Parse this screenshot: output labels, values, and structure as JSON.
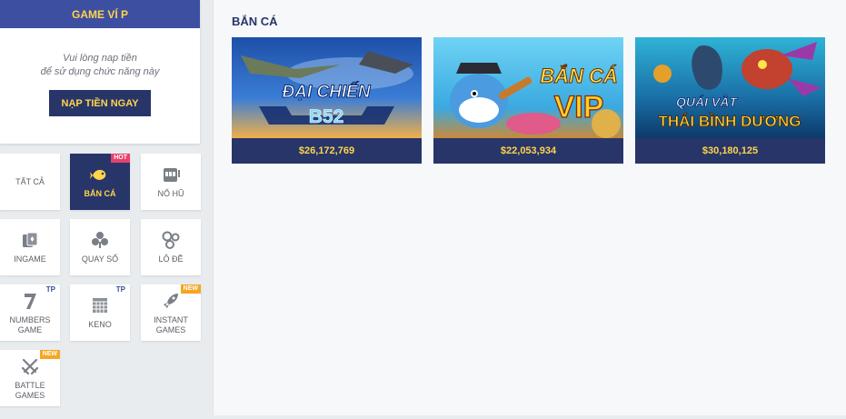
{
  "wallet": {
    "title": "GAME VÍ P",
    "message_line1": "Vui lòng nap tiền",
    "message_line2": "để sử dụng chức năng này",
    "button_label": "NẠP TIỀN NGAY"
  },
  "categories": [
    {
      "label": "TẤT CẢ",
      "icon": "none"
    },
    {
      "label": "BẮN CÁ",
      "icon": "fish-icon",
      "badge": "HOT",
      "active": true
    },
    {
      "label": "NỔ HŨ",
      "icon": "slot-machine-icon"
    },
    {
      "label": "INGAME",
      "icon": "cards-icon"
    },
    {
      "label": "QUAY SỐ",
      "icon": "lottery-icon"
    },
    {
      "label": "LÔ ĐỀ",
      "icon": "balls-icon"
    },
    {
      "label_line1": "NUMBERS",
      "label_line2": "GAME",
      "icon": "seven-icon",
      "badge": "TP"
    },
    {
      "label": "KENO",
      "icon": "keno-icon",
      "badge": "TP"
    },
    {
      "label_line1": "INSTANT",
      "label_line2": "GAMES",
      "icon": "rocket-icon",
      "badge": "NEW"
    },
    {
      "label_line1": "BATTLE",
      "label_line2": "GAMES",
      "icon": "swords-icon",
      "badge": "NEW"
    }
  ],
  "main": {
    "section_title": "BẮN CÁ",
    "games": [
      {
        "art_line1": "ĐẠI CHIẾN",
        "art_line2": "B52",
        "jackpot": "$26,172,769"
      },
      {
        "art_line1": "BẮN CÁ",
        "art_line2": "VIP",
        "jackpot": "$22,053,934"
      },
      {
        "art_line1": "QUÁI VẬT",
        "art_line2": "THÁI BÌNH DƯƠNG",
        "jackpot": "$30,180,125"
      }
    ]
  },
  "colors": {
    "header_blue": "#3d4fa0",
    "navy": "#283569",
    "gold": "#ffd54a",
    "hot_badge": "#e8426b",
    "new_badge": "#f5a623"
  }
}
